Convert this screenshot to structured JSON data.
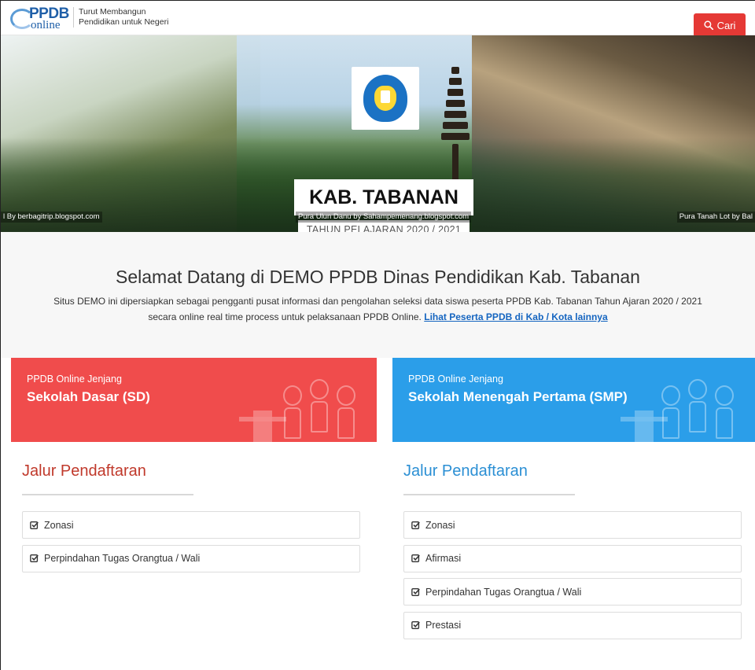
{
  "header": {
    "logo_word": "PPDB",
    "logo_sub": "online",
    "tagline_line1": "Turut Membangun",
    "tagline_line2": "Pendidikan untuk Negeri",
    "search_label": "Cari"
  },
  "hero": {
    "title": "KAB. TABANAN",
    "year": "TAHUN PELAJARAN 2020 / 2021",
    "captions": [
      "l By berbagitrip.blogspot.com",
      "Pura Ulun Danu by Sahampemenang.blogspot.com",
      "Pura Tanah Lot by Bal"
    ]
  },
  "welcome": {
    "heading": "Selamat Datang di DEMO PPDB Dinas Pendidikan Kab. Tabanan",
    "text_line1": "Situs DEMO ini dipersiapkan sebagai pengganti pusat informasi dan pengolahan seleksi data siswa peserta PPDB Kab. Tabanan Tahun Ajaran 2020 / 2021",
    "text_line2": "secara online real time process untuk pelaksanaan PPDB Online.",
    "link": "Lihat Peserta PPDB di Kab / Kota lainnya"
  },
  "panels": {
    "sd": {
      "sub": "PPDB Online Jenjang",
      "title": "Sekolah Dasar (SD)",
      "section": "Jalur Pendaftaran",
      "items": [
        "Zonasi",
        "Perpindahan Tugas Orangtua / Wali"
      ]
    },
    "smp": {
      "sub": "PPDB Online Jenjang",
      "title": "Sekolah Menengah Pertama (SMP)",
      "section": "Jalur Pendaftaran",
      "items": [
        "Zonasi",
        "Afirmasi",
        "Perpindahan Tugas Orangtua / Wali",
        "Prestasi"
      ]
    }
  },
  "colors": {
    "accent_red": "#e53935",
    "sd_header": "#f04c4c",
    "smp_header": "#2b9ee9",
    "link": "#1565c0"
  },
  "icons": {
    "search": "search-icon",
    "item": "check-square-icon"
  }
}
